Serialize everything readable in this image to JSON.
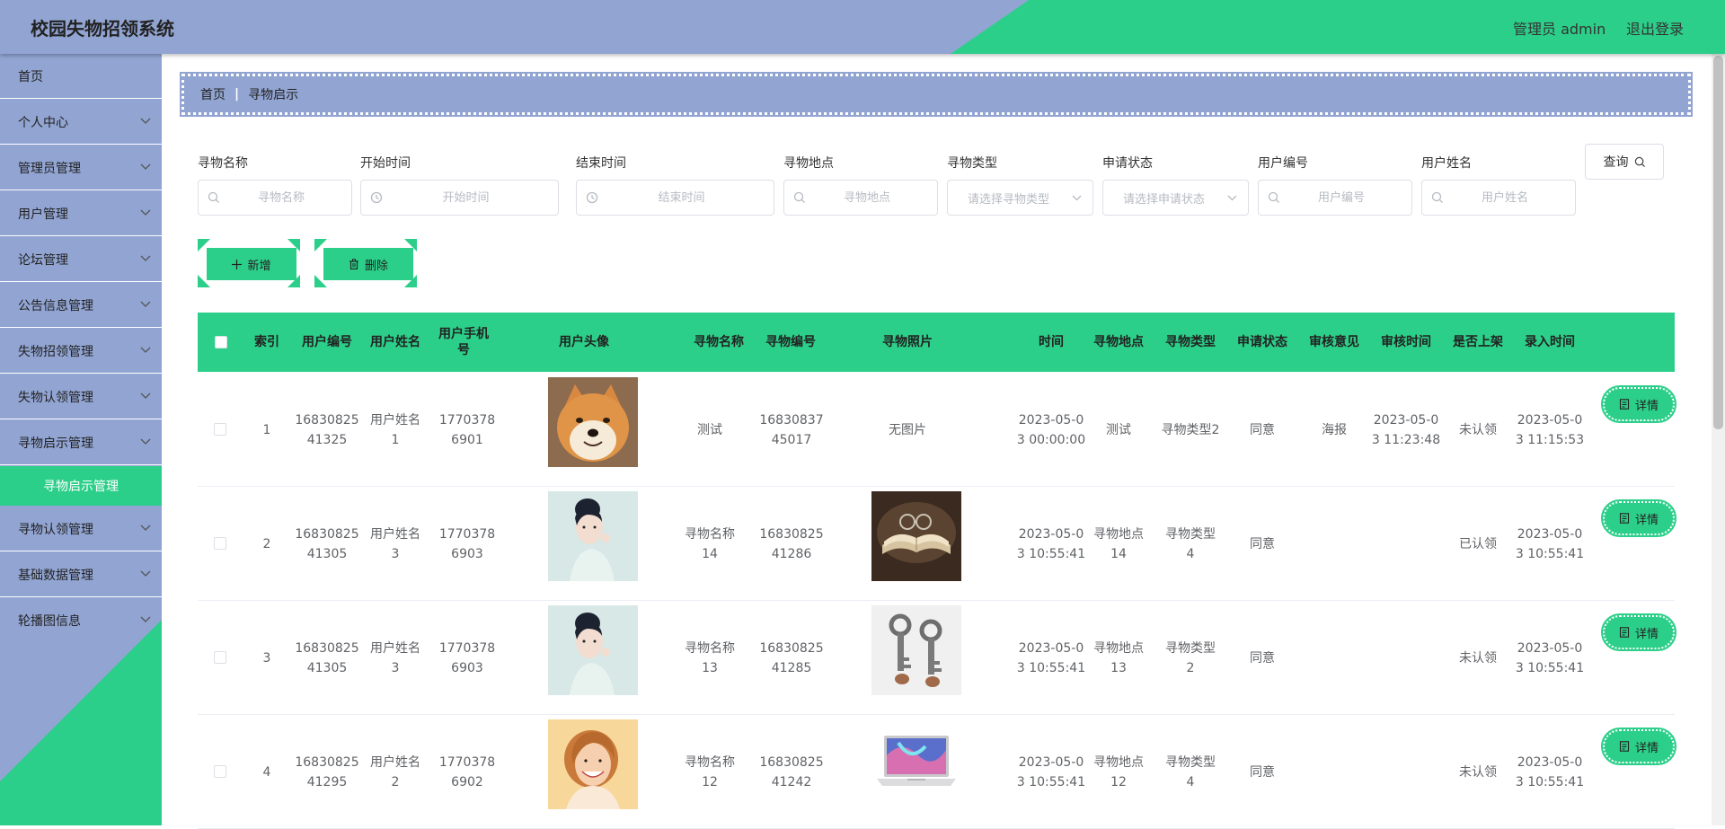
{
  "header": {
    "title": "校园失物招领系统",
    "user_label": "管理员 admin",
    "logout_label": "退出登录"
  },
  "colors": {
    "accent_green": "#2ccf89",
    "accent_blue": "#91a4d2"
  },
  "sidebar": {
    "items": [
      {
        "label": "首页"
      },
      {
        "label": "个人中心"
      },
      {
        "label": "管理员管理"
      },
      {
        "label": "用户管理"
      },
      {
        "label": "论坛管理"
      },
      {
        "label": "公告信息管理"
      },
      {
        "label": "失物招领管理"
      },
      {
        "label": "失物认领管理"
      },
      {
        "label": "寻物启示管理"
      },
      {
        "label": "寻物认领管理"
      },
      {
        "label": "基础数据管理"
      },
      {
        "label": "轮播图信息"
      }
    ],
    "active_sub": "寻物启示管理"
  },
  "breadcrumb": {
    "home": "首页",
    "current": "寻物启示"
  },
  "search": {
    "name_label": "寻物名称",
    "name_placeholder": "寻物名称",
    "start_label": "开始时间",
    "start_placeholder": "开始时间",
    "end_label": "结束时间",
    "end_placeholder": "结束时间",
    "place_label": "寻物地点",
    "place_placeholder": "寻物地点",
    "type_label": "寻物类型",
    "type_placeholder": "请选择寻物类型",
    "status_label": "申请状态",
    "status_placeholder": "请选择申请状态",
    "userno_label": "用户编号",
    "userno_placeholder": "用户编号",
    "username_label": "用户姓名",
    "username_placeholder": "用户姓名",
    "query_label": "查询"
  },
  "actions": {
    "add_label": "新增",
    "delete_label": "删除"
  },
  "table": {
    "headers": {
      "index": "索引",
      "user_no": "用户编号",
      "user_name": "用户姓名",
      "user_phone": "用户手机号",
      "avatar": "用户头像",
      "item_name": "寻物名称",
      "item_no": "寻物编号",
      "item_photo": "寻物照片",
      "time": "时间",
      "place": "寻物地点",
      "type": "寻物类型",
      "status": "申请状态",
      "review_opinion": "审核意见",
      "review_time": "审核时间",
      "listed": "是否上架",
      "entry_time": "录入时间"
    },
    "detail_label": "详情",
    "rows": [
      {
        "index": "1",
        "user_no": "1683082541325",
        "user_name": "用户姓名1",
        "user_phone": "17703786901",
        "avatar": "shiba-dog",
        "item_name": "测试",
        "item_no": "1683083745017",
        "item_photo": "无图片",
        "time": "2023-05-03 00:00:00",
        "place": "测试",
        "type": "寻物类型2",
        "status": "同意",
        "review_opinion": "海报",
        "review_time": "2023-05-03 11:23:48",
        "listed": "未认领",
        "entry_time": "2023-05-03 11:15:53"
      },
      {
        "index": "2",
        "user_no": "1683082541305",
        "user_name": "用户姓名3",
        "user_phone": "17703786903",
        "avatar": "woman-portrait",
        "item_name": "寻物名称14",
        "item_no": "1683082541286",
        "item_photo": "book",
        "time": "2023-05-03 10:55:41",
        "place": "寻物地点14",
        "type": "寻物类型4",
        "status": "同意",
        "review_opinion": "",
        "review_time": "",
        "listed": "已认领",
        "entry_time": "2023-05-03 10:55:41"
      },
      {
        "index": "3",
        "user_no": "1683082541305",
        "user_name": "用户姓名3",
        "user_phone": "17703786903",
        "avatar": "woman-portrait",
        "item_name": "寻物名称13",
        "item_no": "1683082541285",
        "item_photo": "keys",
        "time": "2023-05-03 10:55:41",
        "place": "寻物地点13",
        "type": "寻物类型2",
        "status": "同意",
        "review_opinion": "",
        "review_time": "",
        "listed": "未认领",
        "entry_time": "2023-05-03 10:55:41"
      },
      {
        "index": "4",
        "user_no": "1683082541295",
        "user_name": "用户姓名2",
        "user_phone": "17703786902",
        "avatar": "smiling-woman",
        "item_name": "寻物名称12",
        "item_no": "1683082541242",
        "item_photo": "laptop",
        "time": "2023-05-03 10:55:41",
        "place": "寻物地点12",
        "type": "寻物类型4",
        "status": "同意",
        "review_opinion": "",
        "review_time": "",
        "listed": "未认领",
        "entry_time": "2023-05-03 10:55:41"
      }
    ]
  }
}
